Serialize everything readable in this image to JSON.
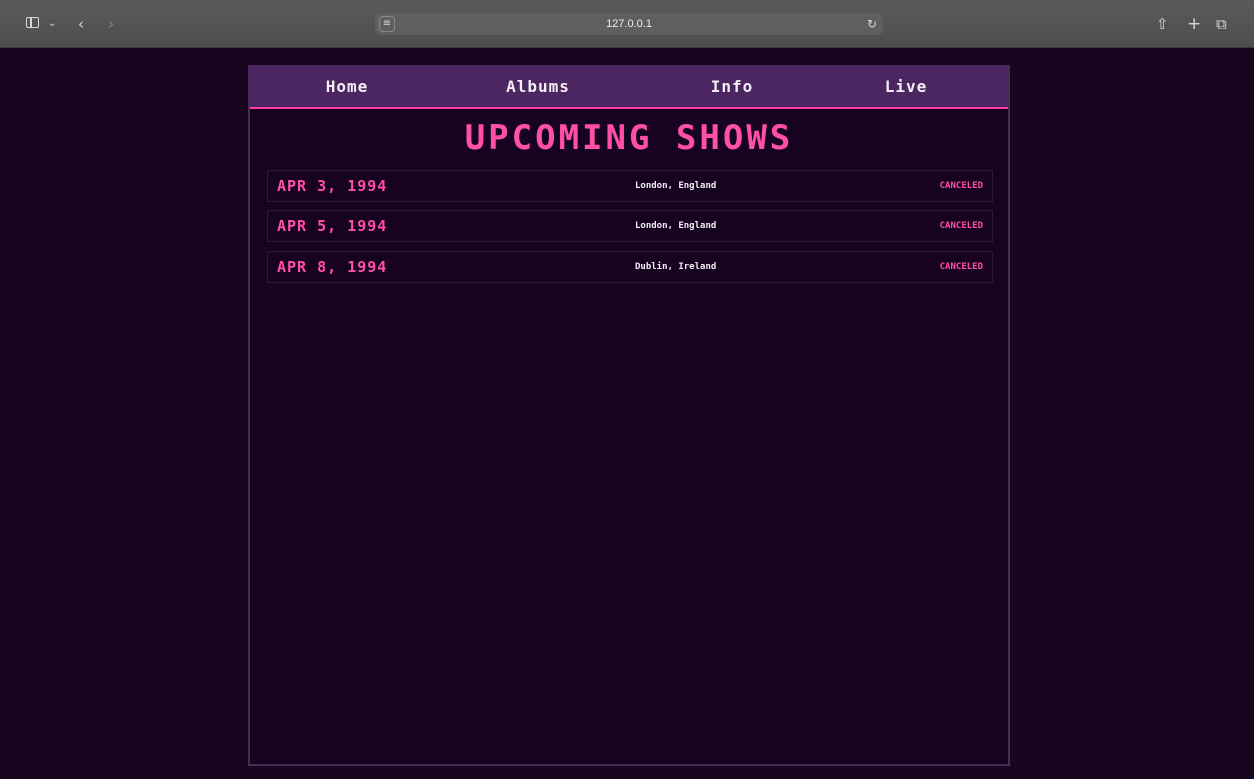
{
  "browser": {
    "url": "127.0.0.1",
    "icons": [
      "sidebar-icon",
      "chevron-down-icon",
      "back-icon",
      "forward-icon",
      "site-icon",
      "reload-icon",
      "share-icon",
      "new-tab-icon",
      "tabs-overview-icon"
    ]
  },
  "nav": {
    "items": [
      {
        "label": "Home"
      },
      {
        "label": "Albums"
      },
      {
        "label": "Info"
      },
      {
        "label": "Live"
      }
    ]
  },
  "page": {
    "heading": "UPCOMING SHOWS",
    "shows": [
      {
        "date": "APR 3, 1994",
        "location": "London, England",
        "status": "CANCELED"
      },
      {
        "date": "APR 5, 1994",
        "location": "London, England",
        "status": "CANCELED"
      },
      {
        "date": "APR 8, 1994",
        "location": "Dublin, Ireland",
        "status": "CANCELED"
      }
    ]
  },
  "colors": {
    "background": "#170320",
    "nav_background": "#4b2660",
    "accent": "#ff4fa8",
    "text": "#f2eef4"
  }
}
